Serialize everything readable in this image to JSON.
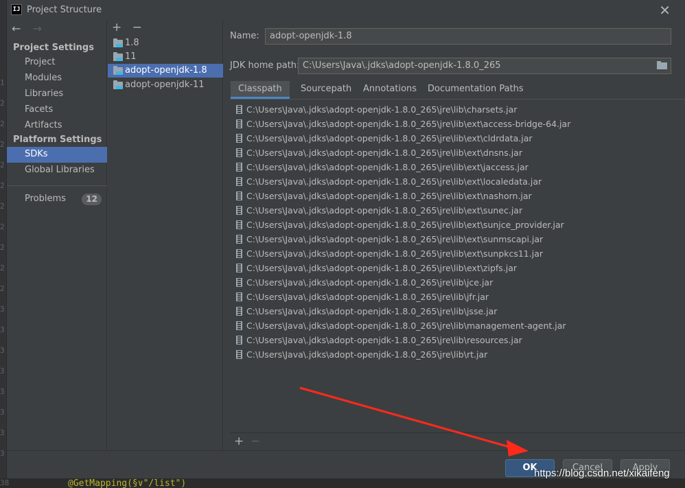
{
  "window": {
    "title": "Project Structure",
    "app_icon_text": "IJ"
  },
  "nav": {
    "back_icon": "←",
    "forward_icon": "→",
    "sections": [
      {
        "label": "Project Settings",
        "items": [
          "Project",
          "Modules",
          "Libraries",
          "Facets",
          "Artifacts"
        ]
      },
      {
        "label": "Platform Settings",
        "items": [
          "SDKs",
          "Global Libraries"
        ]
      }
    ],
    "selected": "SDKs",
    "problems": {
      "label": "Problems",
      "count": "12"
    }
  },
  "sdk_list": {
    "add_icon": "+",
    "remove_icon": "−",
    "items": [
      "1.8",
      "11",
      "adopt-openjdk-1.8",
      "adopt-openjdk-11"
    ],
    "selected": "adopt-openjdk-1.8"
  },
  "detail": {
    "name_label": "Name:",
    "name_value": "adopt-openjdk-1.8",
    "home_label": "JDK home path:",
    "home_value": "C:\\Users\\Java\\.jdks\\adopt-openjdk-1.8.0_265",
    "tabs": [
      "Classpath",
      "Sourcepath",
      "Annotations",
      "Documentation Paths"
    ],
    "active_tab": "Classpath",
    "classpath": [
      "C:\\Users\\Java\\.jdks\\adopt-openjdk-1.8.0_265\\jre\\lib\\charsets.jar",
      "C:\\Users\\Java\\.jdks\\adopt-openjdk-1.8.0_265\\jre\\lib\\ext\\access-bridge-64.jar",
      "C:\\Users\\Java\\.jdks\\adopt-openjdk-1.8.0_265\\jre\\lib\\ext\\cldrdata.jar",
      "C:\\Users\\Java\\.jdks\\adopt-openjdk-1.8.0_265\\jre\\lib\\ext\\dnsns.jar",
      "C:\\Users\\Java\\.jdks\\adopt-openjdk-1.8.0_265\\jre\\lib\\ext\\jaccess.jar",
      "C:\\Users\\Java\\.jdks\\adopt-openjdk-1.8.0_265\\jre\\lib\\ext\\localedata.jar",
      "C:\\Users\\Java\\.jdks\\adopt-openjdk-1.8.0_265\\jre\\lib\\ext\\nashorn.jar",
      "C:\\Users\\Java\\.jdks\\adopt-openjdk-1.8.0_265\\jre\\lib\\ext\\sunec.jar",
      "C:\\Users\\Java\\.jdks\\adopt-openjdk-1.8.0_265\\jre\\lib\\ext\\sunjce_provider.jar",
      "C:\\Users\\Java\\.jdks\\adopt-openjdk-1.8.0_265\\jre\\lib\\ext\\sunmscapi.jar",
      "C:\\Users\\Java\\.jdks\\adopt-openjdk-1.8.0_265\\jre\\lib\\ext\\sunpkcs11.jar",
      "C:\\Users\\Java\\.jdks\\adopt-openjdk-1.8.0_265\\jre\\lib\\ext\\zipfs.jar",
      "C:\\Users\\Java\\.jdks\\adopt-openjdk-1.8.0_265\\jre\\lib\\jce.jar",
      "C:\\Users\\Java\\.jdks\\adopt-openjdk-1.8.0_265\\jre\\lib\\jfr.jar",
      "C:\\Users\\Java\\.jdks\\adopt-openjdk-1.8.0_265\\jre\\lib\\jsse.jar",
      "C:\\Users\\Java\\.jdks\\adopt-openjdk-1.8.0_265\\jre\\lib\\management-agent.jar",
      "C:\\Users\\Java\\.jdks\\adopt-openjdk-1.8.0_265\\jre\\lib\\resources.jar",
      "C:\\Users\\Java\\.jdks\\adopt-openjdk-1.8.0_265\\jre\\lib\\rt.jar"
    ],
    "list_add_icon": "+",
    "list_remove_icon": "−"
  },
  "buttons": {
    "ok": "OK",
    "cancel": "Cancel",
    "apply": "Apply"
  },
  "background_editor": {
    "gutter_numbers": [
      "1",
      "2",
      "2",
      "2",
      "2",
      "2",
      "2",
      "2",
      "2",
      "2",
      "2",
      "3",
      "3",
      "3",
      "3",
      "3",
      "3",
      "3",
      "3"
    ],
    "line_number": "38",
    "code": "@GetMapping(§∨\"/list\")"
  },
  "watermark": "https://blog.csdn.net/xikaifeng",
  "colors": {
    "accent": "#4b6eaf",
    "ok_button": "#365880",
    "arrow": "#ff2a1a"
  }
}
